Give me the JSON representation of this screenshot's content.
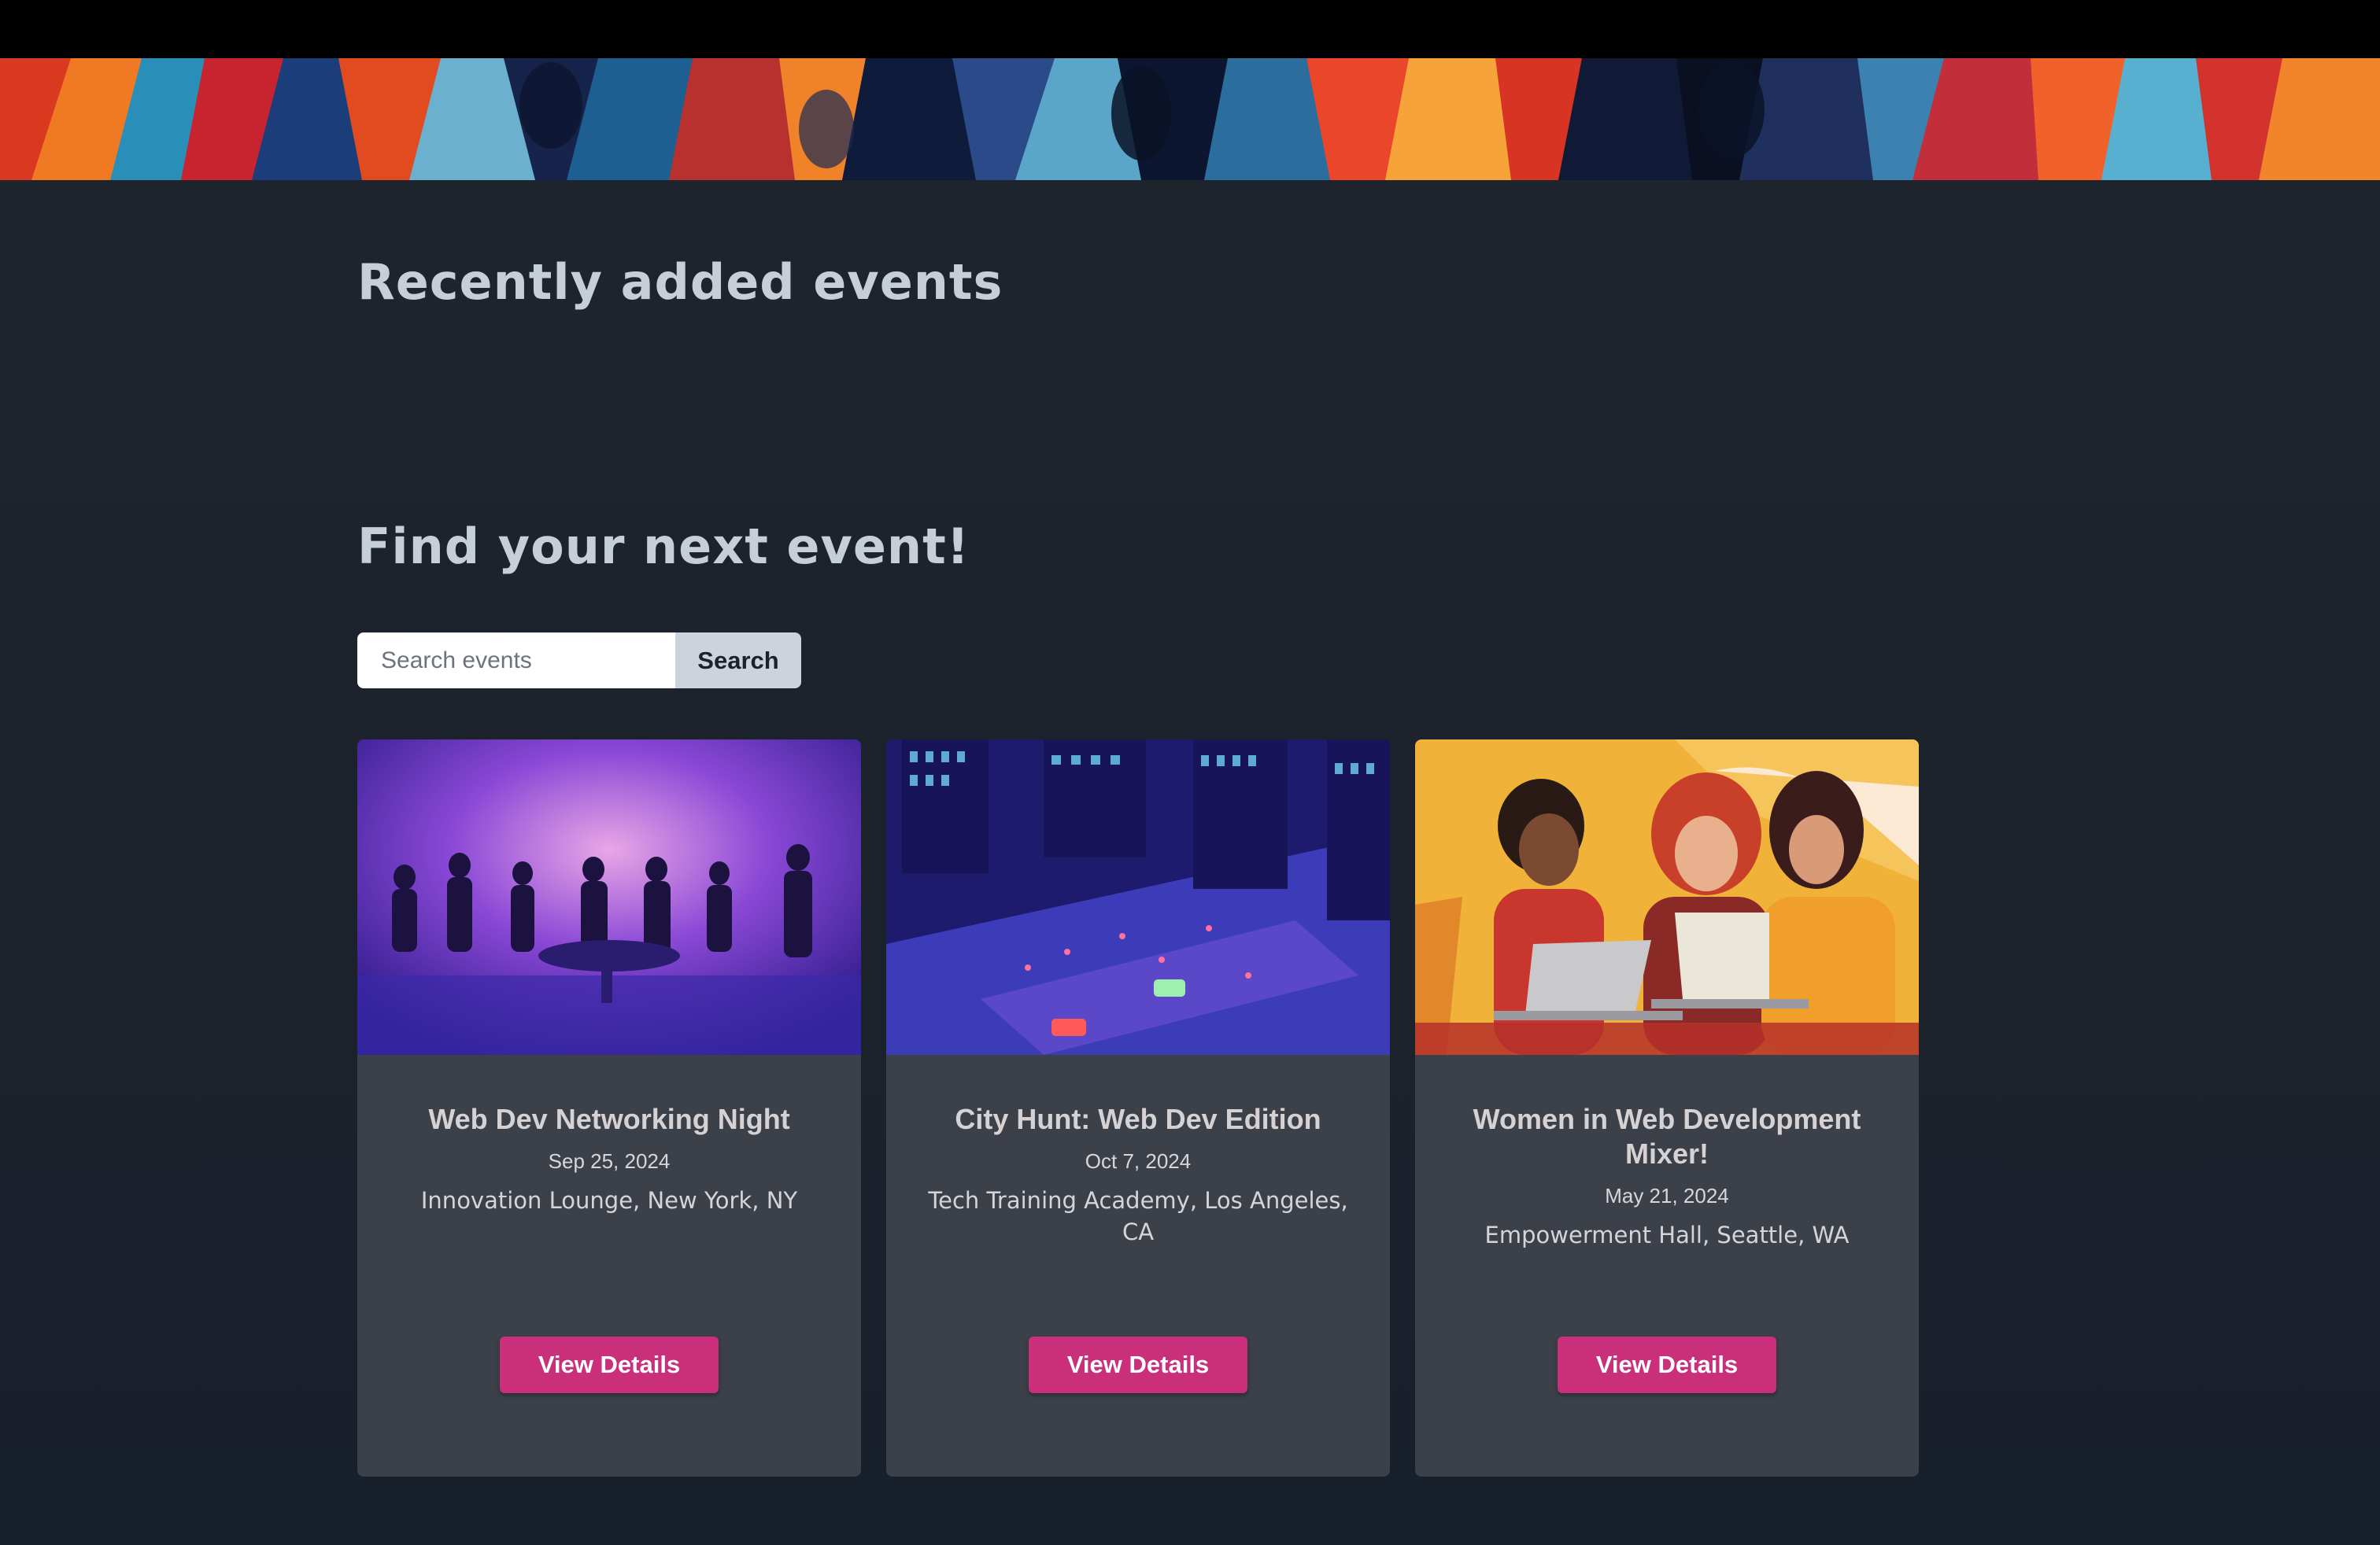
{
  "sections": {
    "recent_heading": "Recently added events",
    "find_heading": "Find your next event!"
  },
  "search": {
    "placeholder": "Search events",
    "button_label": "Search"
  },
  "colors": {
    "background": "#1f242d",
    "card": "#3c4149",
    "accent": "#c92f7b",
    "heading": "#c6ced7"
  },
  "events": [
    {
      "title": "Web Dev Networking Night",
      "date": "Sep 25, 2024",
      "location": "Innovation Lounge, New York, NY",
      "button_label": "View Details",
      "image": "networking-night-illustration"
    },
    {
      "title": "City Hunt: Web Dev Edition",
      "date": "Oct 7, 2024",
      "location": "Tech Training Academy, Los Angeles, CA",
      "button_label": "View Details",
      "image": "city-hunt-illustration"
    },
    {
      "title": "Women in Web Development Mixer!",
      "date": "May 21, 2024",
      "location": "Empowerment Hall, Seattle, WA",
      "button_label": "View Details",
      "image": "women-mixer-illustration"
    }
  ]
}
